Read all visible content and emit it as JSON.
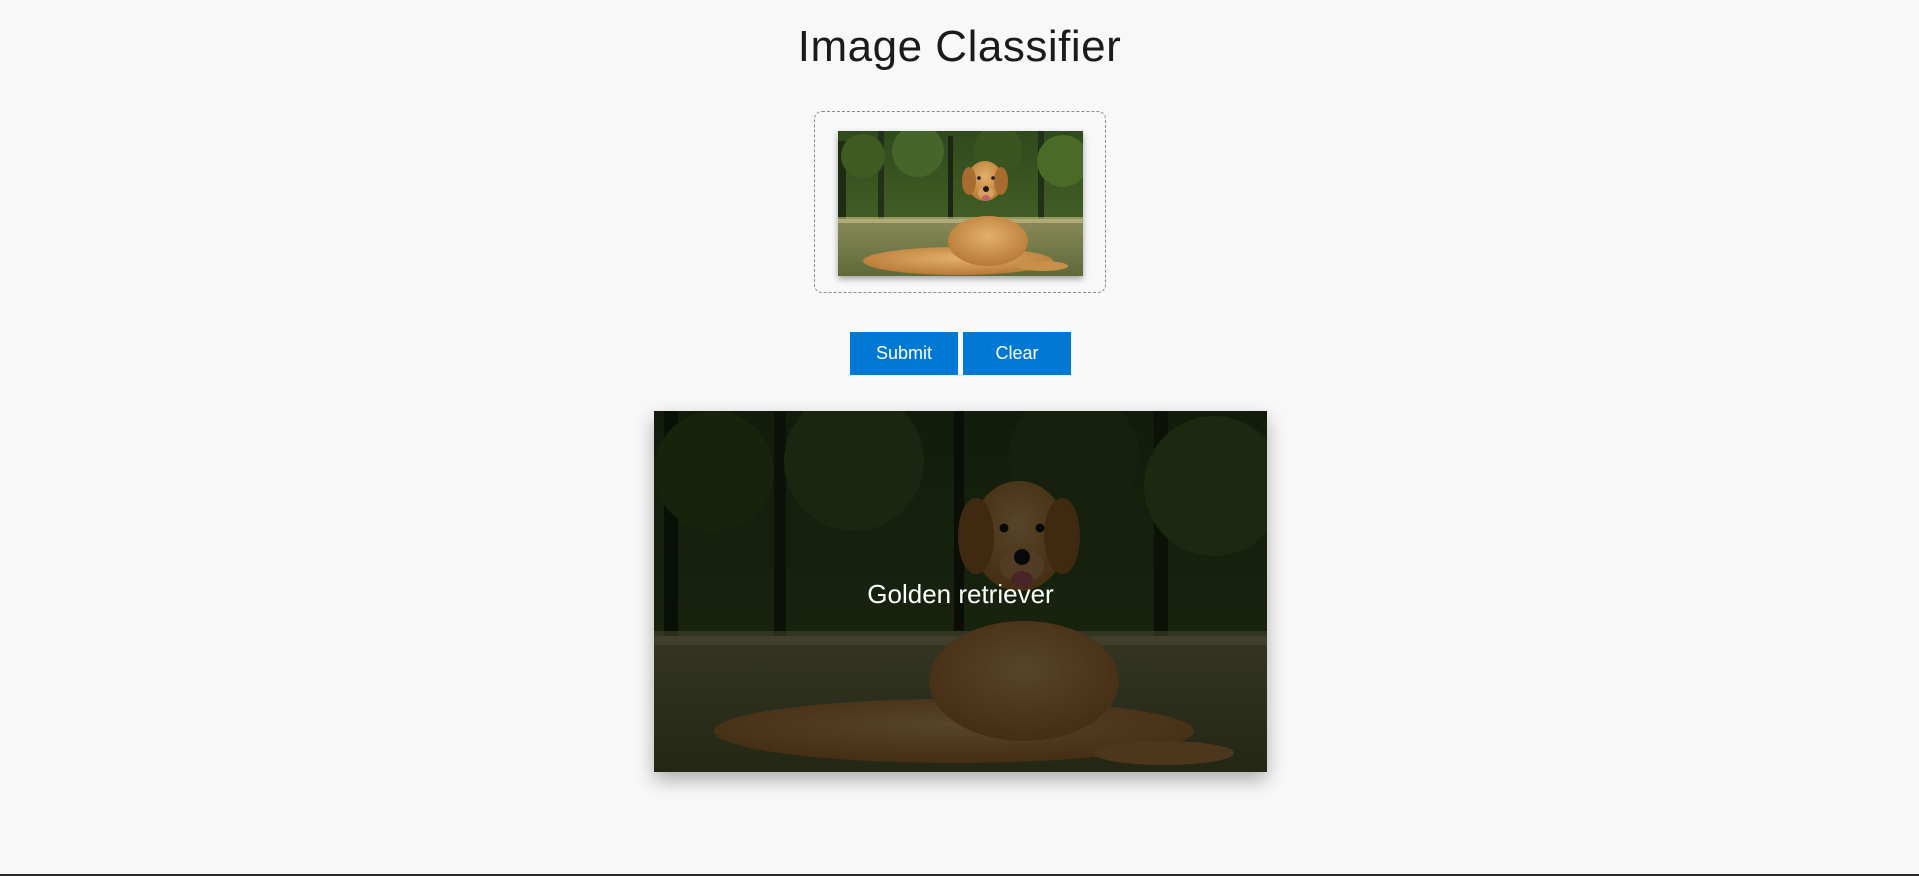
{
  "header": {
    "title": "Image Classifier"
  },
  "upload": {
    "preview_alt": "golden retriever photo"
  },
  "actions": {
    "submit_label": "Submit",
    "clear_label": "Clear"
  },
  "result": {
    "prediction": "Golden retriever"
  },
  "colors": {
    "accent": "#0078d4",
    "background": "#f8f8f8"
  }
}
